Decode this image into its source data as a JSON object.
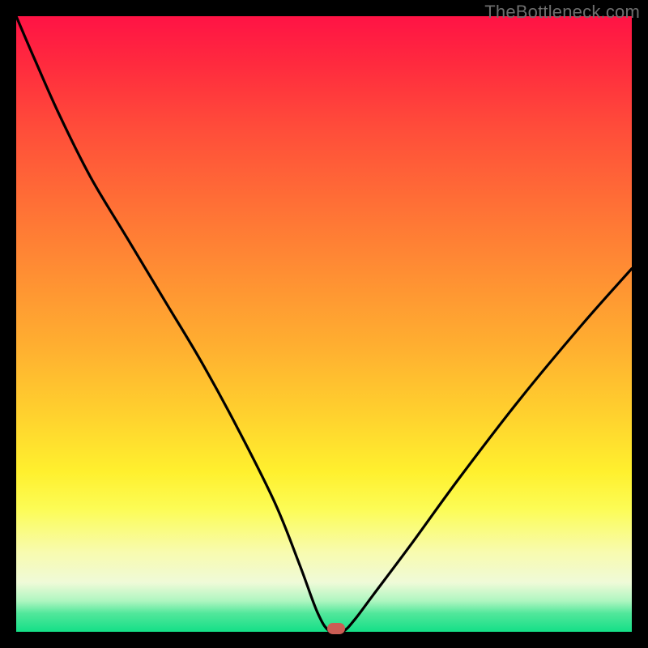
{
  "watermark": "TheBottleneck.com",
  "gradient_colors": {
    "top": "#ff1345",
    "mid_upper": "#ff8f33",
    "mid": "#ffd22e",
    "mid_lower": "#fcfc55",
    "pale": "#effad8",
    "bottom": "#14df87"
  },
  "marker": {
    "color": "#cb5d54"
  },
  "chart_data": {
    "type": "line",
    "title": "",
    "xlabel": "",
    "ylabel": "",
    "xlim": [
      0,
      100
    ],
    "ylim": [
      0,
      100
    ],
    "annotations": [
      {
        "text": "TheBottleneck.com",
        "pos": "top-right"
      }
    ],
    "series": [
      {
        "name": "curve",
        "x": [
          0,
          3,
          7,
          12,
          18,
          24,
          30,
          36,
          42,
          46,
          49,
          51,
          53,
          55,
          58,
          64,
          72,
          82,
          92,
          100
        ],
        "y": [
          100,
          93,
          84,
          74,
          64,
          54,
          44,
          33,
          21,
          11,
          3,
          0,
          0,
          2,
          6,
          14,
          25,
          38,
          50,
          59
        ]
      }
    ],
    "marker_point": {
      "x": 52,
      "y": 0
    },
    "legend": null
  }
}
